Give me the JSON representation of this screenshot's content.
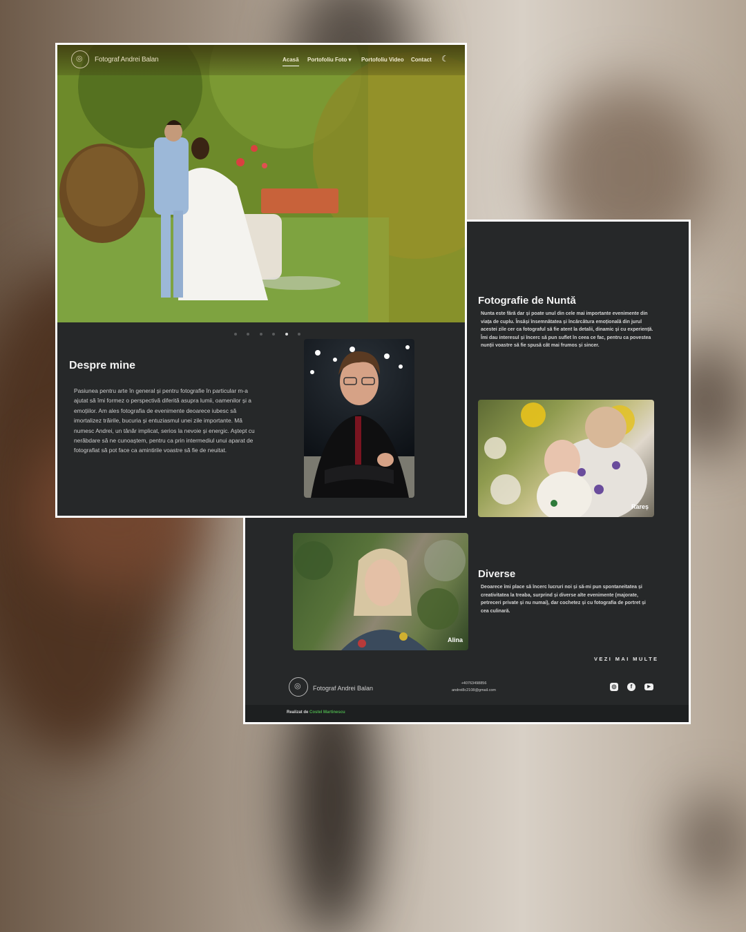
{
  "site": {
    "brand": "Fotograf Andrei Balan",
    "nav": [
      {
        "label": "Acasă",
        "active": true
      },
      {
        "label": "Portofoliu Foto ▾",
        "active": false
      },
      {
        "label": "Portofoliu Video",
        "active": false
      },
      {
        "label": "Contact",
        "active": false
      }
    ],
    "theme_toggle_icon": "moon-icon"
  },
  "carousel": {
    "slide_count": 6,
    "active_index": 4
  },
  "about": {
    "title": "Despre mine",
    "text": "Pasiunea pentru arte în general și pentru fotografie în particular m-a ajutat să îmi formez o perspectivă diferită asupra lumii, oamenilor și a emoțiilor. Am ales fotografia de evenimente deoarece iubesc să imortalizez trăirile, bucuria și entuziasmul unei zile importante. Mă numesc Andrei, un tânăr implicat, serios la nevoie și energic. Aștept cu nerăbdare să ne cunoaștem, pentru ca prin intermediul unui aparat de fotografiat să pot face ca amintirile voastre să fie de neuitat."
  },
  "wedding": {
    "title": "Fotografie de Nuntă",
    "text": "Nunta este fără dar și poate unul din cele mai importante evenimente din viața de cuplu. Însăși însemnătatea și încărcătura emoțională din jurul acestei zile cer ca fotograful să fie atent la detalii, dinamic și cu experiență. Îmi dau interesul și încerc să pun suflet în ceea ce fac, pentru ca povestea nunții voastre să fie spusă cât mai frumos și sincer.",
    "photo_caption": "Rareș"
  },
  "misc": {
    "title": "Diverse",
    "text": "Deoarece îmi place să încerc lucruri noi și să-mi pun spontaneitatea și creativitatea la treaba, surprind și diverse alte evenimente (majorate, petreceri private și nu numai), dar cochetez și cu fotografia de portret și cea culinară.",
    "photo_caption": "Alina",
    "more_label": "VEZI MAI MULTE"
  },
  "footer": {
    "brand": "Fotograf Andrei Balan",
    "phone": "+40763498856",
    "email": "andrei8c2108@gmail.com",
    "social": [
      "instagram-icon",
      "facebook-icon",
      "youtube-icon"
    ],
    "credit_prefix": "Realizat de",
    "credit_name": "Costel Martinescu"
  },
  "colors": {
    "page_bg": "#262829",
    "frame_border": "#ffffff",
    "credit_link": "#4cae4c"
  }
}
